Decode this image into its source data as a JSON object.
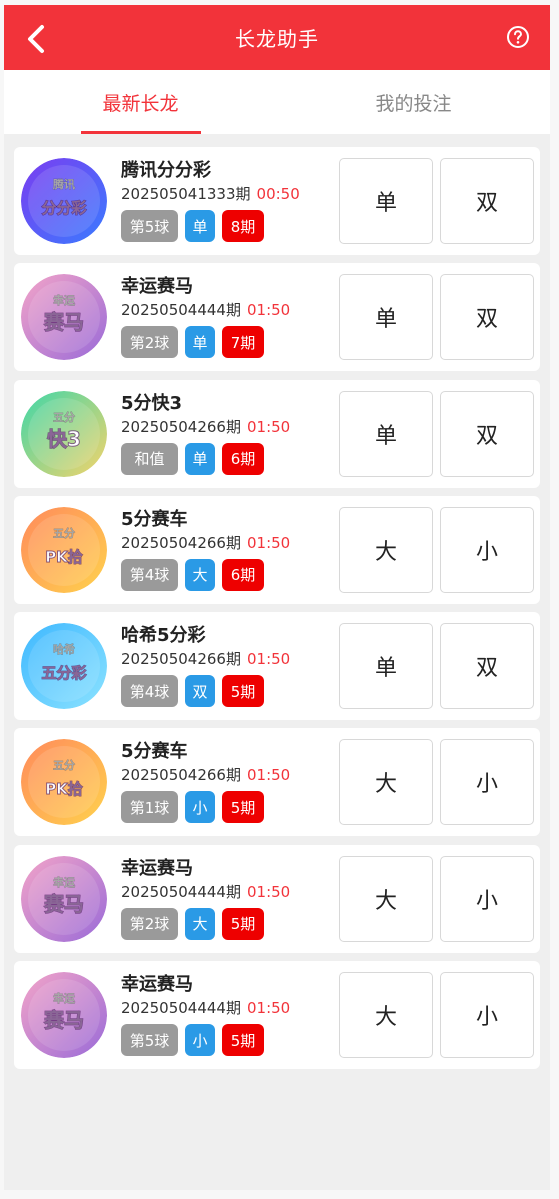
{
  "header": {
    "title": "长龙助手",
    "back_icon": "chevron-left-icon",
    "help_icon": "help-circle-icon"
  },
  "tabs": [
    {
      "label": "最新长龙",
      "active": true
    },
    {
      "label": "我的投注",
      "active": false
    }
  ],
  "cards": [
    {
      "name": "腾讯分分彩",
      "issue": "202505041333期",
      "time": "00:50",
      "ball": "第5球",
      "pick": "单",
      "streak": "8期",
      "options": [
        "单",
        "双"
      ],
      "logo": {
        "line1": "腾讯",
        "line2": "分分彩",
        "bg": [
          "#7b3df0",
          "#3a7bff"
        ]
      }
    },
    {
      "name": "幸运赛马",
      "issue": "20250504444期",
      "time": "01:50",
      "ball": "第2球",
      "pick": "单",
      "streak": "7期",
      "options": [
        "单",
        "双"
      ],
      "logo": {
        "line1": "幸运",
        "line2": "赛马",
        "bg": [
          "#f3a4c8",
          "#9a6bd8"
        ]
      }
    },
    {
      "name": "5分快3",
      "issue": "20250504266期",
      "time": "01:50",
      "ball": "和值",
      "pick": "单",
      "streak": "6期",
      "options": [
        "单",
        "双"
      ],
      "logo": {
        "line1": "五分",
        "line2": "快3",
        "bg": [
          "#3fd6a8",
          "#f5d36b"
        ]
      }
    },
    {
      "name": "5分赛车",
      "issue": "20250504266期",
      "time": "01:50",
      "ball": "第4球",
      "pick": "大",
      "streak": "6期",
      "options": [
        "大",
        "小"
      ],
      "logo": {
        "line1": "五分",
        "line2": "PK拾",
        "bg": [
          "#ff8a5c",
          "#ffd24d"
        ]
      }
    },
    {
      "name": "哈希5分彩",
      "issue": "20250504266期",
      "time": "01:50",
      "ball": "第4球",
      "pick": "双",
      "streak": "5期",
      "options": [
        "单",
        "双"
      ],
      "logo": {
        "line1": "哈希",
        "line2": "五分彩",
        "bg": [
          "#3fb8ff",
          "#8be2ff"
        ]
      }
    },
    {
      "name": "5分赛车",
      "issue": "20250504266期",
      "time": "01:50",
      "ball": "第1球",
      "pick": "小",
      "streak": "5期",
      "options": [
        "大",
        "小"
      ],
      "logo": {
        "line1": "五分",
        "line2": "PK拾",
        "bg": [
          "#ff8a5c",
          "#ffd24d"
        ]
      }
    },
    {
      "name": "幸运赛马",
      "issue": "20250504444期",
      "time": "01:50",
      "ball": "第2球",
      "pick": "大",
      "streak": "5期",
      "options": [
        "大",
        "小"
      ],
      "logo": {
        "line1": "幸运",
        "line2": "赛马",
        "bg": [
          "#f3a4c8",
          "#9a6bd8"
        ]
      }
    },
    {
      "name": "幸运赛马",
      "issue": "20250504444期",
      "time": "01:50",
      "ball": "第5球",
      "pick": "小",
      "streak": "5期",
      "options": [
        "大",
        "小"
      ],
      "logo": {
        "line1": "幸运",
        "line2": "赛马",
        "bg": [
          "#f3a4c8",
          "#9a6bd8"
        ]
      }
    }
  ],
  "colors": {
    "accent": "#f2333a",
    "pick": "#2a9ae6",
    "streak": "#ee0000",
    "ball": "#9a9a9a"
  }
}
